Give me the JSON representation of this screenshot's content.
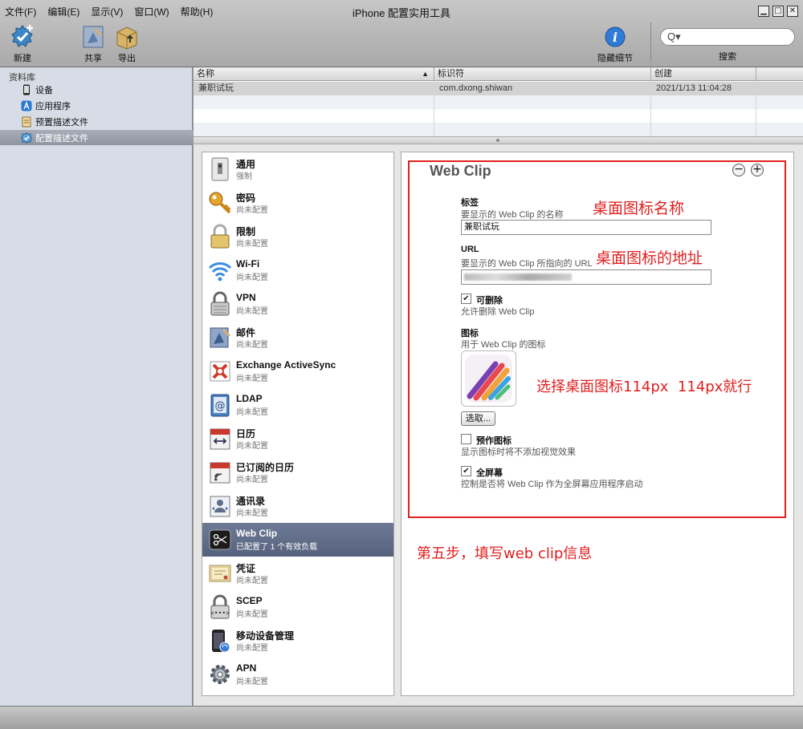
{
  "window": {
    "title": "iPhone 配置实用工具"
  },
  "menu": [
    "文件(F)",
    "编辑(E)",
    "显示(V)",
    "窗口(W)",
    "帮助(H)"
  ],
  "toolbar": {
    "new_label": "新建",
    "share_label": "共享",
    "export_label": "导出",
    "hide_details_label": "隐藏细节",
    "search_label": "搜索",
    "search_placeholder": "",
    "search_icon": "Q▾"
  },
  "sidebar": {
    "header": "资料库",
    "items": [
      {
        "label": "设备",
        "icon": "device-icon"
      },
      {
        "label": "应用程序",
        "icon": "app-icon"
      },
      {
        "label": "预置描述文件",
        "icon": "provisioning-icon"
      },
      {
        "label": "配置描述文件",
        "icon": "config-profile-icon",
        "selected": true
      }
    ]
  },
  "table": {
    "columns": [
      "名称",
      "标识符",
      "创建"
    ],
    "rows": [
      {
        "name": "兼职试玩",
        "identifier": "com.dxong.shiwan",
        "created": "2021/1/13 11:04:28"
      }
    ]
  },
  "payloads": [
    {
      "name": "通用",
      "status": "强制",
      "icon": "general-icon"
    },
    {
      "name": "密码",
      "status": "尚未配置",
      "icon": "key-icon"
    },
    {
      "name": "限制",
      "status": "尚未配置",
      "icon": "lock-icon"
    },
    {
      "name": "Wi-Fi",
      "status": "尚未配置",
      "icon": "wifi-icon"
    },
    {
      "name": "VPN",
      "status": "尚未配置",
      "icon": "vpn-lock-icon"
    },
    {
      "name": "邮件",
      "status": "尚未配置",
      "icon": "mail-icon"
    },
    {
      "name": "Exchange ActiveSync",
      "status": "尚未配置",
      "icon": "exchange-icon"
    },
    {
      "name": "LDAP",
      "status": "尚未配置",
      "icon": "ldap-icon"
    },
    {
      "name": "日历",
      "status": "尚未配置",
      "icon": "calendar-icon"
    },
    {
      "name": "已订阅的日历",
      "status": "尚未配置",
      "icon": "subscribed-calendar-icon"
    },
    {
      "name": "通讯录",
      "status": "尚未配置",
      "icon": "contacts-icon"
    },
    {
      "name": "Web Clip",
      "status": "已配置了 1 个有效负载",
      "icon": "web-clip-icon",
      "selected": true
    },
    {
      "name": "凭证",
      "status": "尚未配置",
      "icon": "certificate-icon"
    },
    {
      "name": "SCEP",
      "status": "尚未配置",
      "icon": "scep-icon"
    },
    {
      "name": "移动设备管理",
      "status": "尚未配置",
      "icon": "mdm-icon"
    },
    {
      "name": "APN",
      "status": "尚未配置",
      "icon": "gear-icon"
    }
  ],
  "webclip": {
    "title": "Web Clip",
    "minus": "−",
    "plus": "+",
    "label_title": "标签",
    "label_desc": "要显示的 Web Clip 的名称",
    "label_value": "兼职试玩",
    "url_title": "URL",
    "url_desc": "要显示的 Web Clip 所指向的 URL",
    "removable_title": "可删除",
    "removable_desc": "允许删除 Web Clip",
    "removable_checked": "✔",
    "icon_title": "图标",
    "icon_desc": "用于 Web Clip 的图标",
    "select_button": "选取...",
    "precomposed_title": "预作图标",
    "precomposed_desc": "显示图标时将不添加视觉效果",
    "precomposed_checked": "",
    "fullscreen_title": "全屏幕",
    "fullscreen_desc": "控制是否将 Web Clip 作为全屏幕应用程序启动",
    "fullscreen_checked": "✔"
  },
  "annotations": {
    "name": "桌面图标名称",
    "url": "桌面图标的地址",
    "icon": "选择桌面图标114px  114px就行",
    "step": "第五步，填写web clip信息",
    "color": "#e02020"
  }
}
